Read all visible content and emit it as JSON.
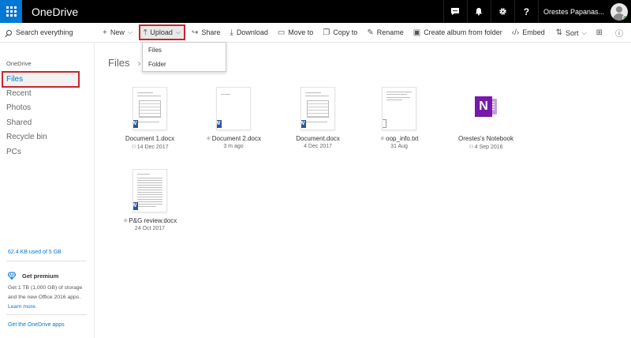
{
  "app": {
    "name": "OneDrive"
  },
  "topbar": {
    "user_name": "Orestes Papanas...",
    "chat_icon": "chat-icon",
    "bell_icon": "bell-icon",
    "gear_icon": "gear-icon",
    "help_label": "?"
  },
  "search": {
    "placeholder": "Search everything"
  },
  "toolbar": {
    "new_label": "New",
    "upload_label": "Upload",
    "share_label": "Share",
    "download_label": "Download",
    "move_label": "Move to",
    "copy_label": "Copy to",
    "rename_label": "Rename",
    "album_label": "Create album from folder",
    "embed_label": "Embed",
    "sort_label": "Sort"
  },
  "upload_menu": {
    "items": [
      "Files",
      "Folder"
    ]
  },
  "sidebar": {
    "header": "OneDrive",
    "items": [
      "Files",
      "Recent",
      "Photos",
      "Shared",
      "Recycle bin",
      "PCs"
    ],
    "storage": "62.4 KB used of 5 GB",
    "premium_title": "Get premium",
    "premium_text": "Get 1 TB (1,000 GB) of storage and the new Office 2016 apps.",
    "learn_more": "Learn more.",
    "get_apps": "Get the OneDrive apps"
  },
  "breadcrumb": {
    "root": "Files"
  },
  "files": [
    {
      "name": "Document 1.docx",
      "meta": "14 Dec 2017",
      "type": "word",
      "shared": true,
      "new": false
    },
    {
      "name": "Document 2.docx",
      "meta": "3 m ago",
      "type": "word",
      "shared": false,
      "new": true
    },
    {
      "name": "Document.docx",
      "meta": "4 Dec 2017",
      "type": "word",
      "shared": false,
      "new": false
    },
    {
      "name": "oop_info.txt",
      "meta": "31 Aug",
      "type": "text",
      "shared": false,
      "new": true
    },
    {
      "name": "Orestes's Notebook",
      "meta": "4 Sep 2016",
      "type": "onenote",
      "shared": true,
      "new": false
    },
    {
      "name": "P&G review.docx",
      "meta": "24 Oct 2017",
      "type": "word",
      "shared": false,
      "new": true
    }
  ],
  "colors": {
    "accent": "#0078d4",
    "highlight": "#c8252c",
    "word": "#2b579a",
    "onenote": "#7719aa"
  }
}
